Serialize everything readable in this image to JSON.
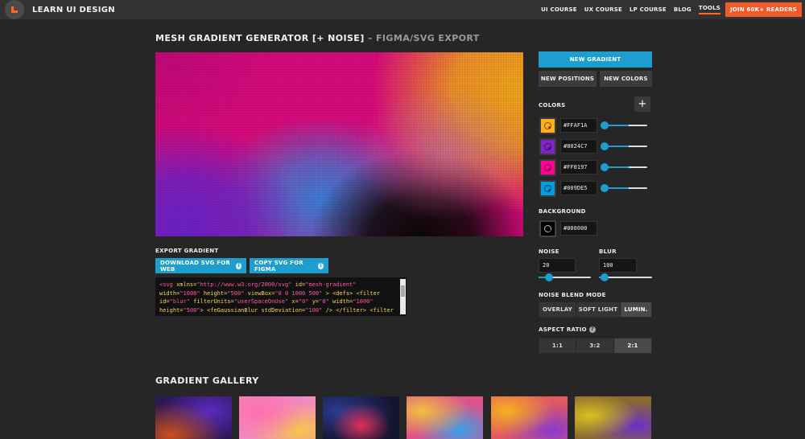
{
  "brand": {
    "name": "LEARN UI DESIGN"
  },
  "nav": {
    "links": [
      "UI COURSE",
      "UX COURSE",
      "LP COURSE",
      "BLOG",
      "TOOLS"
    ],
    "active": "TOOLS",
    "cta": "JOIN 60K+ READERS"
  },
  "title": {
    "main": "MESH GRADIENT GENERATOR [+ NOISE]",
    "sub": " – FIGMA/SVG EXPORT"
  },
  "export": {
    "label": "EXPORT GRADIENT",
    "download_label": "DOWNLOAD SVG FOR WEB",
    "copy_label": "COPY SVG FOR FIGMA",
    "code_lines": [
      "<svg xmlns=\"http://www.w3.org/2000/svg\" id=\"mesh-gradient\"",
      "width=\"1000\" height=\"500\" viewBox=\"0 0 1000 500\" > <defs> <filter",
      "id=\"blur\" filterUnits=\"userSpaceOnUse\" x=\"0\" y=\"0\" width=\"1000\"",
      "height=\"500\"> <feGaussianBlur stdDeviation=\"100\" /> </filter> <filter"
    ]
  },
  "controls": {
    "new_gradient": "NEW GRADIENT",
    "new_positions": "NEW POSITIONS",
    "new_colors": "NEW COLORS",
    "colors_label": "COLORS",
    "add_icon": "plus-icon",
    "colors": [
      {
        "hex": "#FFAF1A",
        "value": 0.6
      },
      {
        "hex": "#8024C7",
        "value": 0.6
      },
      {
        "hex": "#FF0197",
        "value": 0.6
      },
      {
        "hex": "#009DE5",
        "value": 0.6
      }
    ],
    "background_label": "BACKGROUND",
    "background_hex": "#000000",
    "noise_label": "NOISE",
    "noise_value": "20",
    "noise_level": 0.2,
    "blur_label": "BLUR",
    "blur_value": "100",
    "blur_level": 0.1,
    "blend_label": "NOISE BLEND MODE",
    "blend_options": [
      "OVERLAY",
      "SOFT LIGHT",
      "LUMIN."
    ],
    "blend_selected": "LUMIN.",
    "aspect_label": "ASPECT RATIO",
    "aspect_options": [
      "1:1",
      "3:2",
      "2:1"
    ],
    "aspect_selected": "2:1"
  },
  "gallery": {
    "title": "GRADIENT GALLERY"
  },
  "colors": {
    "accent": "#1C9FCF",
    "cta": "#F05A2A",
    "background": "#262626"
  }
}
